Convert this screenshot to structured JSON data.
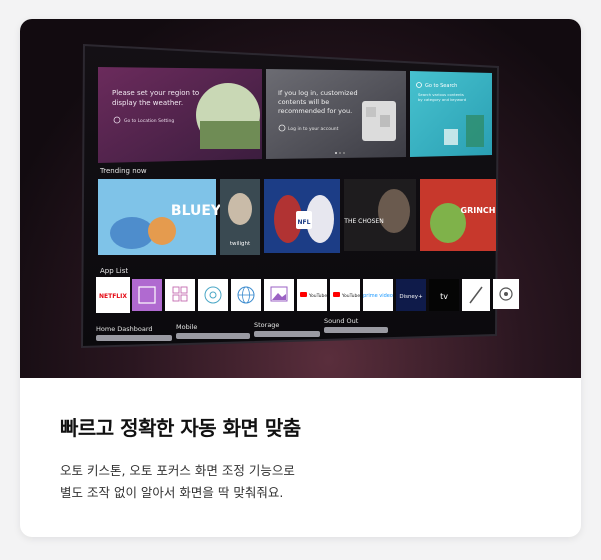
{
  "tv": {
    "weather_card": {
      "text_1": "Please set your region to",
      "text_2": "display the weather.",
      "link": "Go to Location Setting"
    },
    "login_card": {
      "text_1": "If you log in, customized",
      "text_2": "contents will be",
      "text_3": "recommended for you.",
      "link": "Log in to your account"
    },
    "search_card": {
      "title": "Go to Search",
      "sub_1": "Search various contents",
      "sub_2": "by category and keyword"
    },
    "trending": {
      "label": "Trending now",
      "tiles": [
        {
          "title": "BLUEY",
          "color": "#7fc3e8"
        },
        {
          "title": "twilight",
          "color": "#3a4a52"
        },
        {
          "title": "NFL",
          "color": "#1c3d86"
        },
        {
          "title": "THE CHOSEN",
          "color": "#1e1c1e"
        },
        {
          "title": "GRINCH",
          "color": "#c7382c"
        }
      ]
    },
    "app_list": {
      "label": "App List",
      "apps": [
        {
          "name": "NETFLIX",
          "icon": "netflix-logo"
        },
        {
          "name": "",
          "icon": "screen-share-icon"
        },
        {
          "name": "",
          "icon": "apps-grid-icon"
        },
        {
          "name": "",
          "icon": "target-icon"
        },
        {
          "name": "",
          "icon": "globe-icon"
        },
        {
          "name": "",
          "icon": "gallery-icon"
        },
        {
          "name": "YouTube",
          "icon": "youtube-icon"
        },
        {
          "name": "YouTube",
          "icon": "youtube-icon"
        },
        {
          "name": "prime video",
          "icon": "prime-video-logo"
        },
        {
          "name": "Disney+",
          "icon": "disney-plus-logo"
        },
        {
          "name": "tv",
          "icon": "apple-tv-logo"
        },
        {
          "name": "",
          "icon": "pencil-icon"
        },
        {
          "name": "",
          "icon": "gear-icon"
        }
      ]
    },
    "bottom_tabs": [
      "Home Dashboard",
      "Mobile",
      "Storage",
      "Sound Out"
    ]
  },
  "headline": "빠르고 정확한 자동 화면 맞춤",
  "description": {
    "line_1": "오토 키스톤, 오토 포커스 화면 조정 기능으로",
    "line_2": "별도 조작 없이 알아서 화면을 딱 맞춰줘요."
  },
  "colors": {
    "accent_netflix": "#e50914",
    "search_teal": "#35b3c4",
    "app_purple": "#b06ad0"
  }
}
